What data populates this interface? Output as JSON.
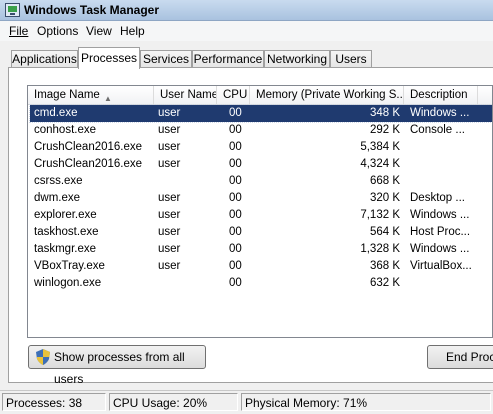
{
  "window": {
    "title": "Windows Task Manager"
  },
  "menu": {
    "items": [
      "File",
      "Options",
      "View",
      "Help"
    ]
  },
  "tabs": [
    "Applications",
    "Processes",
    "Services",
    "Performance",
    "Networking",
    "Users"
  ],
  "active_tab": "Processes",
  "table": {
    "columns": [
      "Image Name",
      "User Name",
      "CPU",
      "Memory (Private Working S...",
      "Description"
    ],
    "rows": [
      [
        "cmd.exe",
        "user",
        "00",
        "348 K",
        "Windows ..."
      ],
      [
        "conhost.exe",
        "user",
        "00",
        "292 K",
        "Console ..."
      ],
      [
        "CrushClean2016.exe",
        "user",
        "00",
        "5,384 K",
        ""
      ],
      [
        "CrushClean2016.exe",
        "user",
        "00",
        "4,324 K",
        ""
      ],
      [
        "csrss.exe",
        "",
        "00",
        "668 K",
        ""
      ],
      [
        "dwm.exe",
        "user",
        "00",
        "320 K",
        "Desktop ..."
      ],
      [
        "explorer.exe",
        "user",
        "00",
        "7,132 K",
        "Windows ..."
      ],
      [
        "taskhost.exe",
        "user",
        "00",
        "564 K",
        "Host Proc..."
      ],
      [
        "taskmgr.exe",
        "user",
        "00",
        "1,328 K",
        "Windows ..."
      ],
      [
        "VBoxTray.exe",
        "user",
        "00",
        "368 K",
        "VirtualBox..."
      ],
      [
        "winlogon.exe",
        "",
        "00",
        "632 K",
        ""
      ]
    ],
    "selected_row": 0
  },
  "buttons": {
    "show_all": "Show processes from all users",
    "end_process": "End Proce"
  },
  "status": {
    "processes": "Processes: 38",
    "cpu": "CPU Usage: 20%",
    "memory": "Physical Memory: 71%"
  }
}
